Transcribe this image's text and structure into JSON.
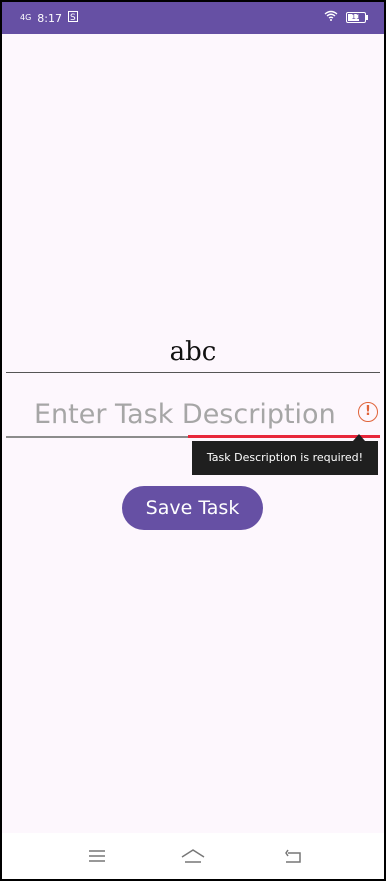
{
  "status_bar": {
    "network": "4G",
    "time": "8:17",
    "app_icon": "s-app-icon",
    "wifi_icon": "wifi-icon",
    "battery_icon": "battery-icon",
    "battery_level": "11"
  },
  "form": {
    "title_value": "abc",
    "description_placeholder": "Enter Task Description",
    "description_error": "Task Description is required!",
    "error_icon": "alert-icon",
    "save_label": "Save Task"
  },
  "nav_bar": {
    "menu_icon": "menu-icon",
    "home_icon": "home-icon",
    "back_icon": "back-icon"
  },
  "colors": {
    "accent": "#6650a4",
    "error": "#e8273a",
    "background": "#fdf7fd"
  }
}
